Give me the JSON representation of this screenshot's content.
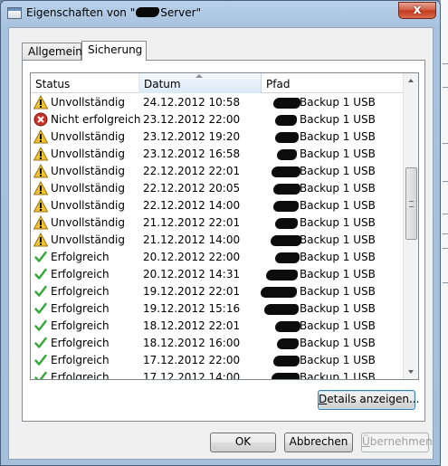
{
  "window": {
    "title_prefix": "Eigenschaften von \"",
    "title_suffix": "Server\"",
    "close_label": "x"
  },
  "tabs": [
    {
      "label": "Allgemein"
    },
    {
      "label": "Sicherung"
    }
  ],
  "table": {
    "columns": [
      "Status",
      "Datum",
      "Pfad"
    ],
    "rows": [
      {
        "icon": "warning",
        "status": "Unvollständig",
        "date": "24.12.2012 10:58",
        "path": "Backup 1 USB"
      },
      {
        "icon": "error",
        "status": "Nicht erfolgreich",
        "date": "23.12.2012 22:00",
        "path": "Backup 1 USB"
      },
      {
        "icon": "warning",
        "status": "Unvollständig",
        "date": "23.12.2012 19:20",
        "path": "Backup 1 USB"
      },
      {
        "icon": "warning",
        "status": "Unvollständig",
        "date": "23.12.2012 16:58",
        "path": "Backup 1 USB"
      },
      {
        "icon": "warning",
        "status": "Unvollständig",
        "date": "22.12.2012 22:01",
        "path": "Backup 1 USB"
      },
      {
        "icon": "warning",
        "status": "Unvollständig",
        "date": "22.12.2012 20:05",
        "path": "Backup 1 USB"
      },
      {
        "icon": "warning",
        "status": "Unvollständig",
        "date": "22.12.2012 14:00",
        "path": "Backup 1 USB"
      },
      {
        "icon": "warning",
        "status": "Unvollständig",
        "date": "21.12.2012 22:01",
        "path": "Backup 1 USB"
      },
      {
        "icon": "warning",
        "status": "Unvollständig",
        "date": "21.12.2012 14:00",
        "path": "Backup 1 USB"
      },
      {
        "icon": "success",
        "status": "Erfolgreich",
        "date": "20.12.2012 22:00",
        "path": "Backup 1 USB"
      },
      {
        "icon": "success",
        "status": "Erfolgreich",
        "date": "20.12.2012 14:31",
        "path": "Backup 1 USB"
      },
      {
        "icon": "success",
        "status": "Erfolgreich",
        "date": "19.12.2012 22:01",
        "path": "Backup 1 USB"
      },
      {
        "icon": "success",
        "status": "Erfolgreich",
        "date": "19.12.2012 15:16",
        "path": "Backup 1 USB"
      },
      {
        "icon": "success",
        "status": "Erfolgreich",
        "date": "18.12.2012 22:01",
        "path": "Backup 1 USB"
      },
      {
        "icon": "success",
        "status": "Erfolgreich",
        "date": "18.12.2012 16:00",
        "path": "Backup 1 USB"
      },
      {
        "icon": "success",
        "status": "Erfolgreich",
        "date": "17.12.2012 22:00",
        "path": "Backup 1 USB"
      },
      {
        "icon": "success",
        "status": "Erfolgreich",
        "date": "17.12.2012 14:00",
        "path": "Backup 1 USB"
      }
    ]
  },
  "buttons": {
    "details_u": "D",
    "details_rest": "etails anzeigen...",
    "ok": "OK",
    "cancel": "Abbrechen",
    "apply_u": "Ü",
    "apply_rest": "bernehmen"
  },
  "colors": {
    "warning": "#f2c12e",
    "error": "#c9332a",
    "success": "#35a83a"
  }
}
